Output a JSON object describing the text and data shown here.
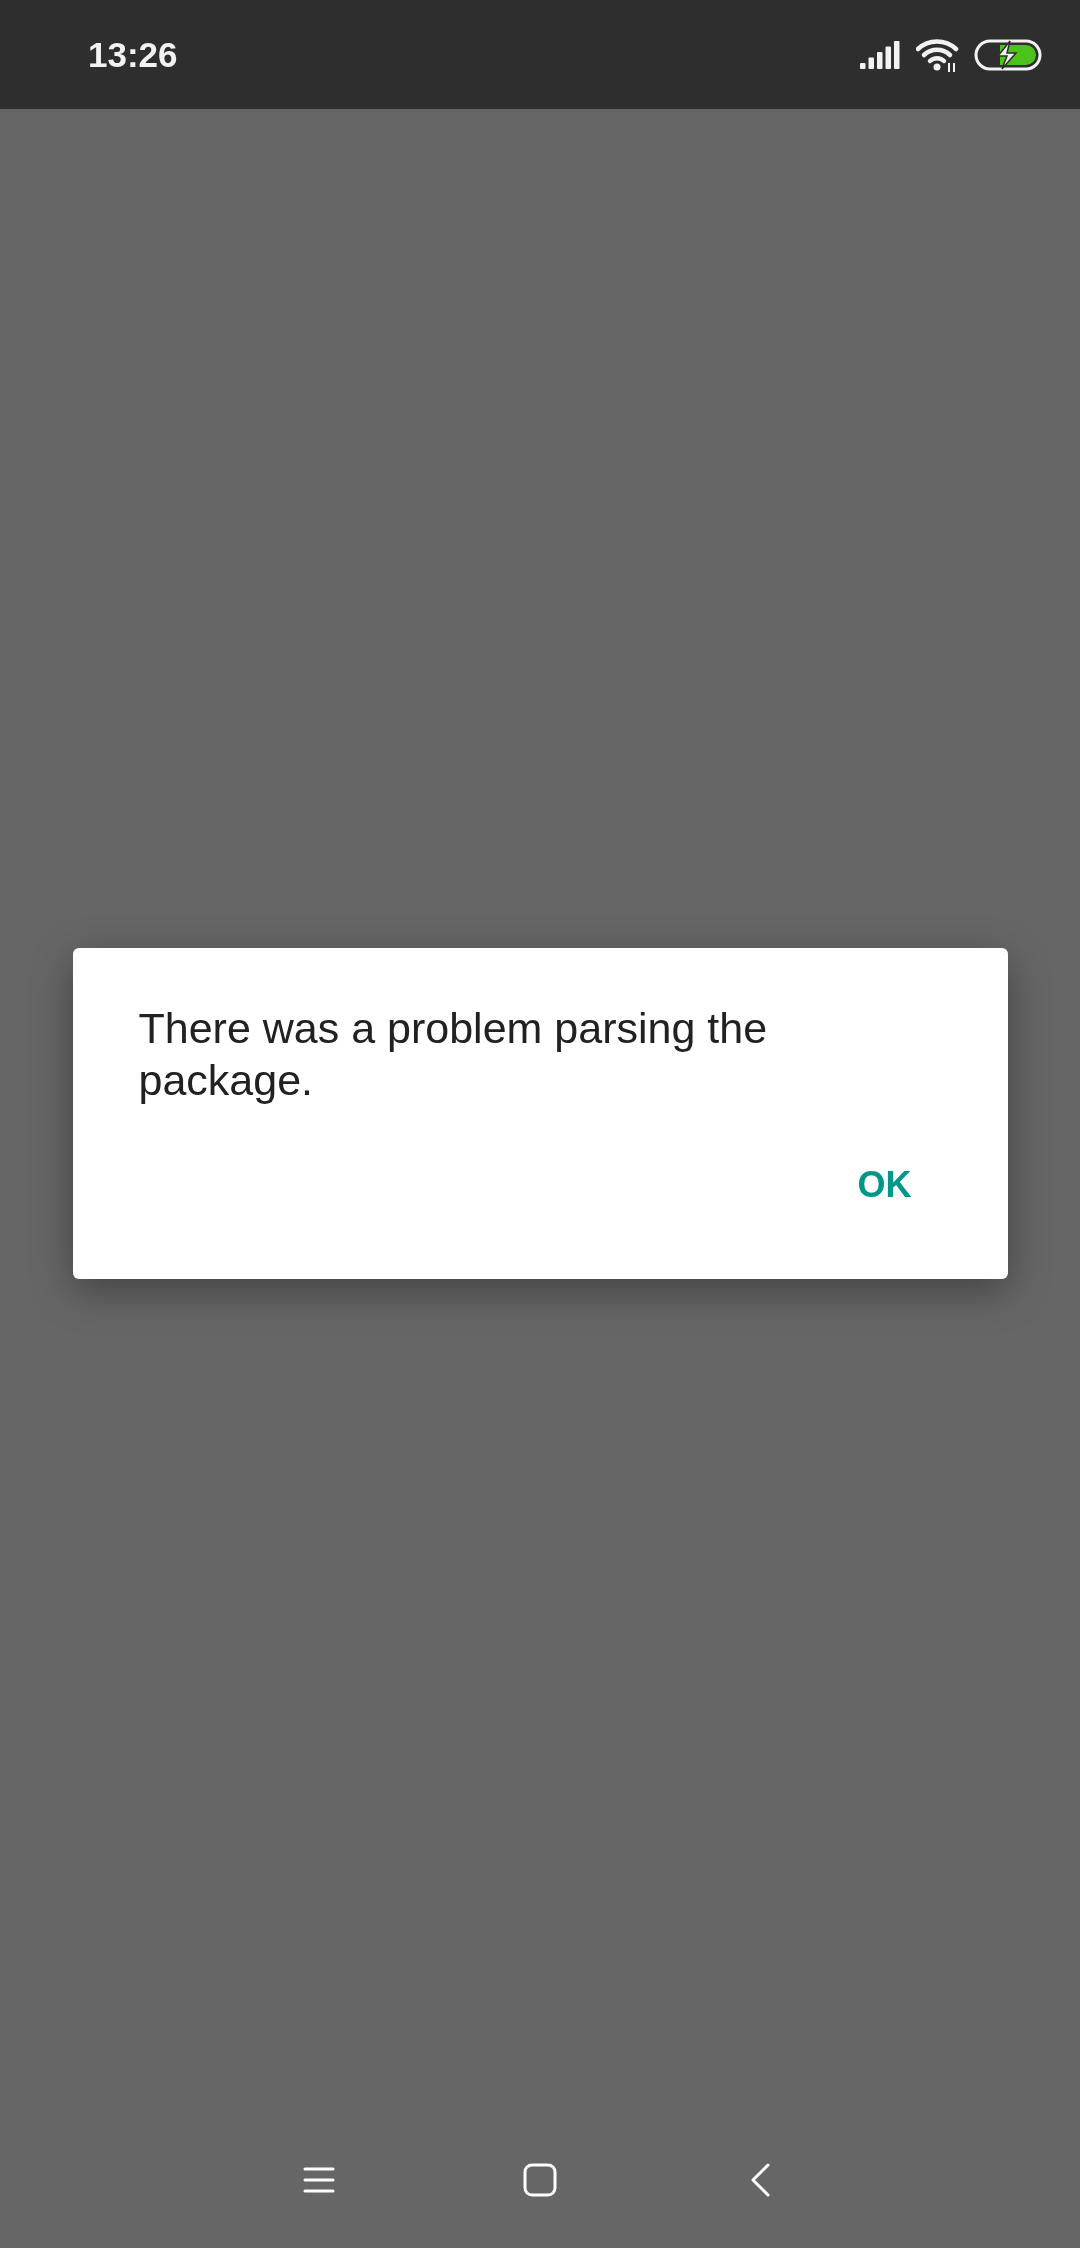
{
  "status_bar": {
    "time": "13:26"
  },
  "dialog": {
    "message": "There was a problem parsing the package.",
    "buttons": [
      "OK"
    ]
  }
}
